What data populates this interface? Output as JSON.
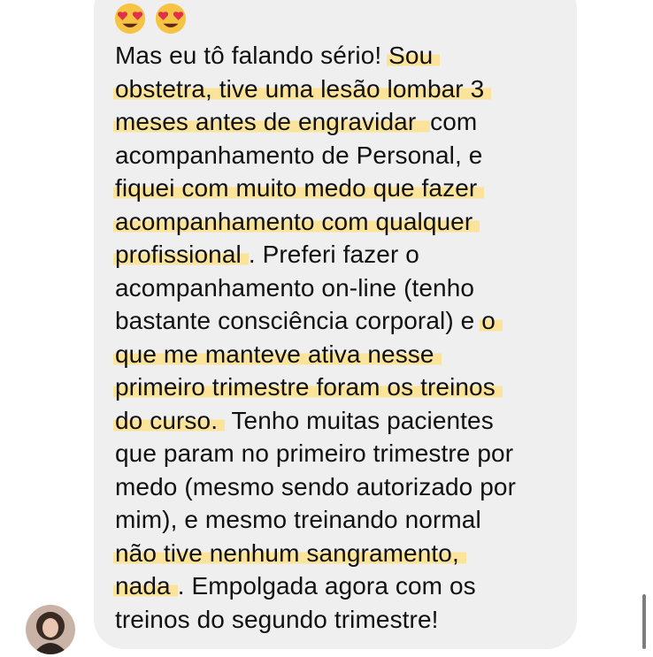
{
  "message": {
    "emojis": [
      "heart-eyes-emoji",
      "heart-eyes-emoji"
    ],
    "lines": [
      [
        {
          "t": "Mas eu tô falando sério! ",
          "hl": false
        },
        {
          "t": "Sou",
          "hl": true
        }
      ],
      [
        {
          "t": "obstetra, tive uma lesão lombar 3",
          "hl": true
        }
      ],
      [
        {
          "t": "meses antes de engravidar ",
          "hl": true
        },
        {
          "t": "com",
          "hl": false
        }
      ],
      [
        {
          "t": "acompanhamento de Personal, e",
          "hl": false
        }
      ],
      [
        {
          "t": "fiquei com muito medo que fazer",
          "hl": true
        }
      ],
      [
        {
          "t": "acompanhamento com qualquer",
          "hl": true
        }
      ],
      [
        {
          "t": "profissional",
          "hl": true
        },
        {
          "t": ". Preferi fazer o",
          "hl": false
        }
      ],
      [
        {
          "t": "acompanhamento on-line (tenho",
          "hl": false
        }
      ],
      [
        {
          "t": "bastante consciência corporal) e ",
          "hl": false
        },
        {
          "t": "o",
          "hl": true
        }
      ],
      [
        {
          "t": "que me manteve ativa nesse",
          "hl": true
        }
      ],
      [
        {
          "t": "primeiro trimestre foram os treinos",
          "hl": true
        }
      ],
      [
        {
          "t": "do curso.",
          "hl": true
        },
        {
          "t": " Tenho muitas pacientes",
          "hl": false
        }
      ],
      [
        {
          "t": "que param no primeiro trimestre por",
          "hl": false
        }
      ],
      [
        {
          "t": "medo (mesmo sendo autorizado por",
          "hl": false
        }
      ],
      [
        {
          "t": "mim), e mesmo treinando normal",
          "hl": false
        }
      ],
      [
        {
          "t": "não tive nenhum sangramento,",
          "hl": true
        }
      ],
      [
        {
          "t": "nada",
          "hl": true
        },
        {
          "t": ". Empolgada agora com os",
          "hl": false
        }
      ],
      [
        {
          "t": "treinos do segundo trimestre!",
          "hl": false
        }
      ]
    ]
  },
  "colors": {
    "bubble": "#efefef",
    "highlight": "#fbe49a",
    "text": "#111111"
  },
  "sender": {
    "avatar_icon": "user-avatar-photo"
  }
}
